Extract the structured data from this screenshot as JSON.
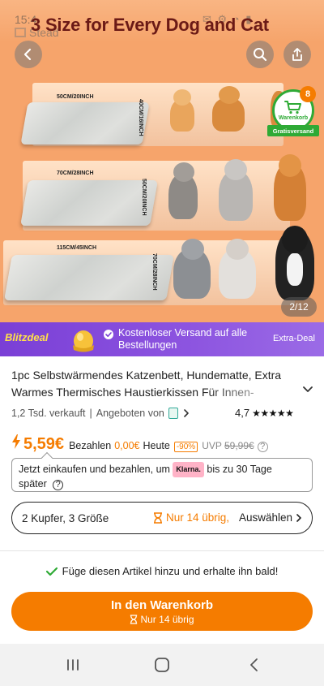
{
  "status_bar": {
    "time": "15:4"
  },
  "hero": {
    "title": "3 Size for Every Dog and Cat",
    "brand": "Stead",
    "sizes": [
      {
        "width": "50CM/20INCH",
        "depth": "40CM/16INCH"
      },
      {
        "width": "70CM/28INCH",
        "depth": "50CM/20INCH"
      },
      {
        "width": "115CM/45INCH",
        "depth": "70CM/28INCH"
      }
    ],
    "cart_badge": {
      "count": "8",
      "label": "Warenkorb",
      "ribbon": "Gratisversand"
    },
    "image_counter": "2/12"
  },
  "blitzdeal": {
    "logo": "Blitzdeal",
    "message": "Kostenloser Versand auf alle Bestellungen",
    "extra": "Extra-Deal"
  },
  "product": {
    "title": "1pc Selbstwärmendes Katzenbett, Hundematte, Extra Warmes Thermisches Haustierkissen Für Innen-",
    "sold": "1,2 Tsd. verkauft",
    "offered_by": "Angeboten von",
    "rating": "4,7",
    "rating_value": 4.7,
    "price": "5,59€",
    "pay_label": "Bezahlen",
    "pay_value": "0,00€",
    "pay_today": "Heute",
    "discount": "-90%",
    "uvp_label": "UVP",
    "uvp_price": "59,99€"
  },
  "klarna": {
    "text_before": "Jetzt einkaufen und bezahlen, um",
    "tag": "Klarna.",
    "text_after": "bis zu 30 Tage",
    "line2": "später"
  },
  "variant": {
    "name": "2 Kupfer, 3 Größe",
    "stock": "Nur 14 übrig,",
    "select": "Auswählen"
  },
  "add_note": "Füge diesen Artikel hinzu und erhalte ihn bald!",
  "cta": {
    "label": "In den Warenkorb",
    "sub": "Nur 14 übrig"
  },
  "colors": {
    "accent": "#f57c00",
    "purple": "#7a3fd6",
    "green": "#2eaa35",
    "hero_bg": "#f6a46b"
  }
}
